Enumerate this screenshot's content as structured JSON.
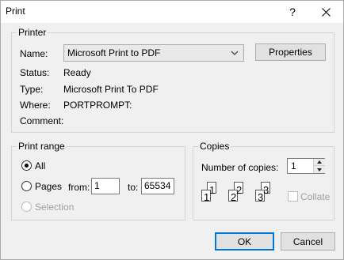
{
  "window": {
    "title": "Print",
    "help_label": "?"
  },
  "printer_group": {
    "label": "Printer",
    "name_label": "Name:",
    "name_value": "Microsoft Print to PDF",
    "properties_label": "Properties",
    "status_label": "Status:",
    "status_value": "Ready",
    "type_label": "Type:",
    "type_value": "Microsoft Print To PDF",
    "where_label": "Where:",
    "where_value": "PORTPROMPT:",
    "comment_label": "Comment:"
  },
  "print_range": {
    "label": "Print range",
    "all_label": "All",
    "pages_label": "Pages",
    "from_label": "from:",
    "from_value": "1",
    "to_label": "to:",
    "to_value": "65534",
    "selection_label": "Selection",
    "selected": "all"
  },
  "copies": {
    "label": "Copies",
    "number_label": "Number of copies:",
    "number_value": "1",
    "collate_label": "Collate",
    "page_numbers": [
      "1",
      "1",
      "2",
      "2",
      "3",
      "3"
    ]
  },
  "footer": {
    "ok_label": "OK",
    "cancel_label": "Cancel"
  },
  "icons": {
    "close": "close-icon",
    "dropdown": "chevron-down-icon",
    "spin_up": "spin-up-icon",
    "spin_down": "spin-down-icon"
  },
  "colors": {
    "accent": "#0078d7",
    "dialog_bg": "#f0f0f0",
    "disabled_text": "#a0a0a0"
  }
}
